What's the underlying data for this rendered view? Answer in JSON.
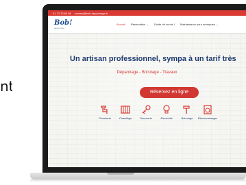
{
  "side_text": "nt",
  "topbar": {
    "phone": "01 73 75 80 56",
    "email": "contact@bob-depannage.fr"
  },
  "logo": {
    "text": "Bob!",
    "subtitle": "depannage"
  },
  "nav": {
    "items": [
      {
        "label": "Accueil",
        "active": true
      },
      {
        "label": "Réservation ⌄",
        "active": false
      },
      {
        "label": "Guide de survie !",
        "active": false
      },
      {
        "label": "Maintenance pour entreprise ⌄",
        "active": false
      }
    ]
  },
  "hero": {
    "headline": "Un artisan professionnel, sympa à un tarif très",
    "tagline": "Dépannage - Bricolage - Travaux",
    "cta_label": "Réservez en ligne"
  },
  "services": [
    {
      "label": "Plomberie",
      "icon": "faucet-icon"
    },
    {
      "label": "Chauffage",
      "icon": "radiator-icon"
    },
    {
      "label": "Serrurerie",
      "icon": "key-icon"
    },
    {
      "label": "Electricité",
      "icon": "lightbulb-icon"
    },
    {
      "label": "Bricolage",
      "icon": "hammer-icon"
    },
    {
      "label": "Électroménager",
      "icon": "appliance-icon"
    }
  ],
  "colors": {
    "brand_red": "#d93a33",
    "brand_blue": "#1f3b6e",
    "bezel": "#1b1b1b"
  }
}
